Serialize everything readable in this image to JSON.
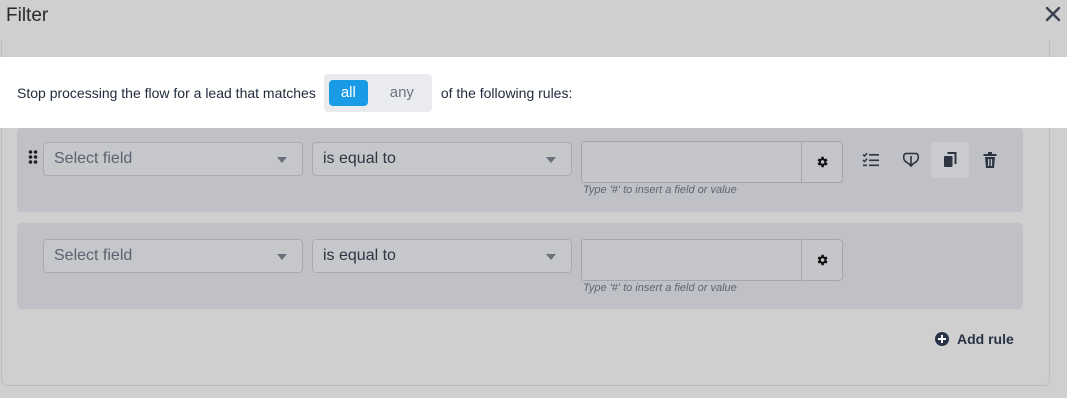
{
  "dialog": {
    "title": "Filter"
  },
  "match": {
    "prefix": "Stop processing the flow for a lead that matches",
    "options": {
      "all": "all",
      "any": "any"
    },
    "selected": "all",
    "suffix": "of the following rules:"
  },
  "rules": [
    {
      "field": "Select field",
      "operator": "is equal to",
      "value": "",
      "hint": "Type '#' to insert a field or value"
    },
    {
      "field": "Select field",
      "operator": "is equal to",
      "value": "",
      "hint": "Type '#' to insert a field or value"
    }
  ],
  "actions": {
    "add_rule": "Add rule"
  },
  "colors": {
    "accent": "#1a9be6",
    "dark": "#283347",
    "overlay": "#cfcfcf"
  }
}
